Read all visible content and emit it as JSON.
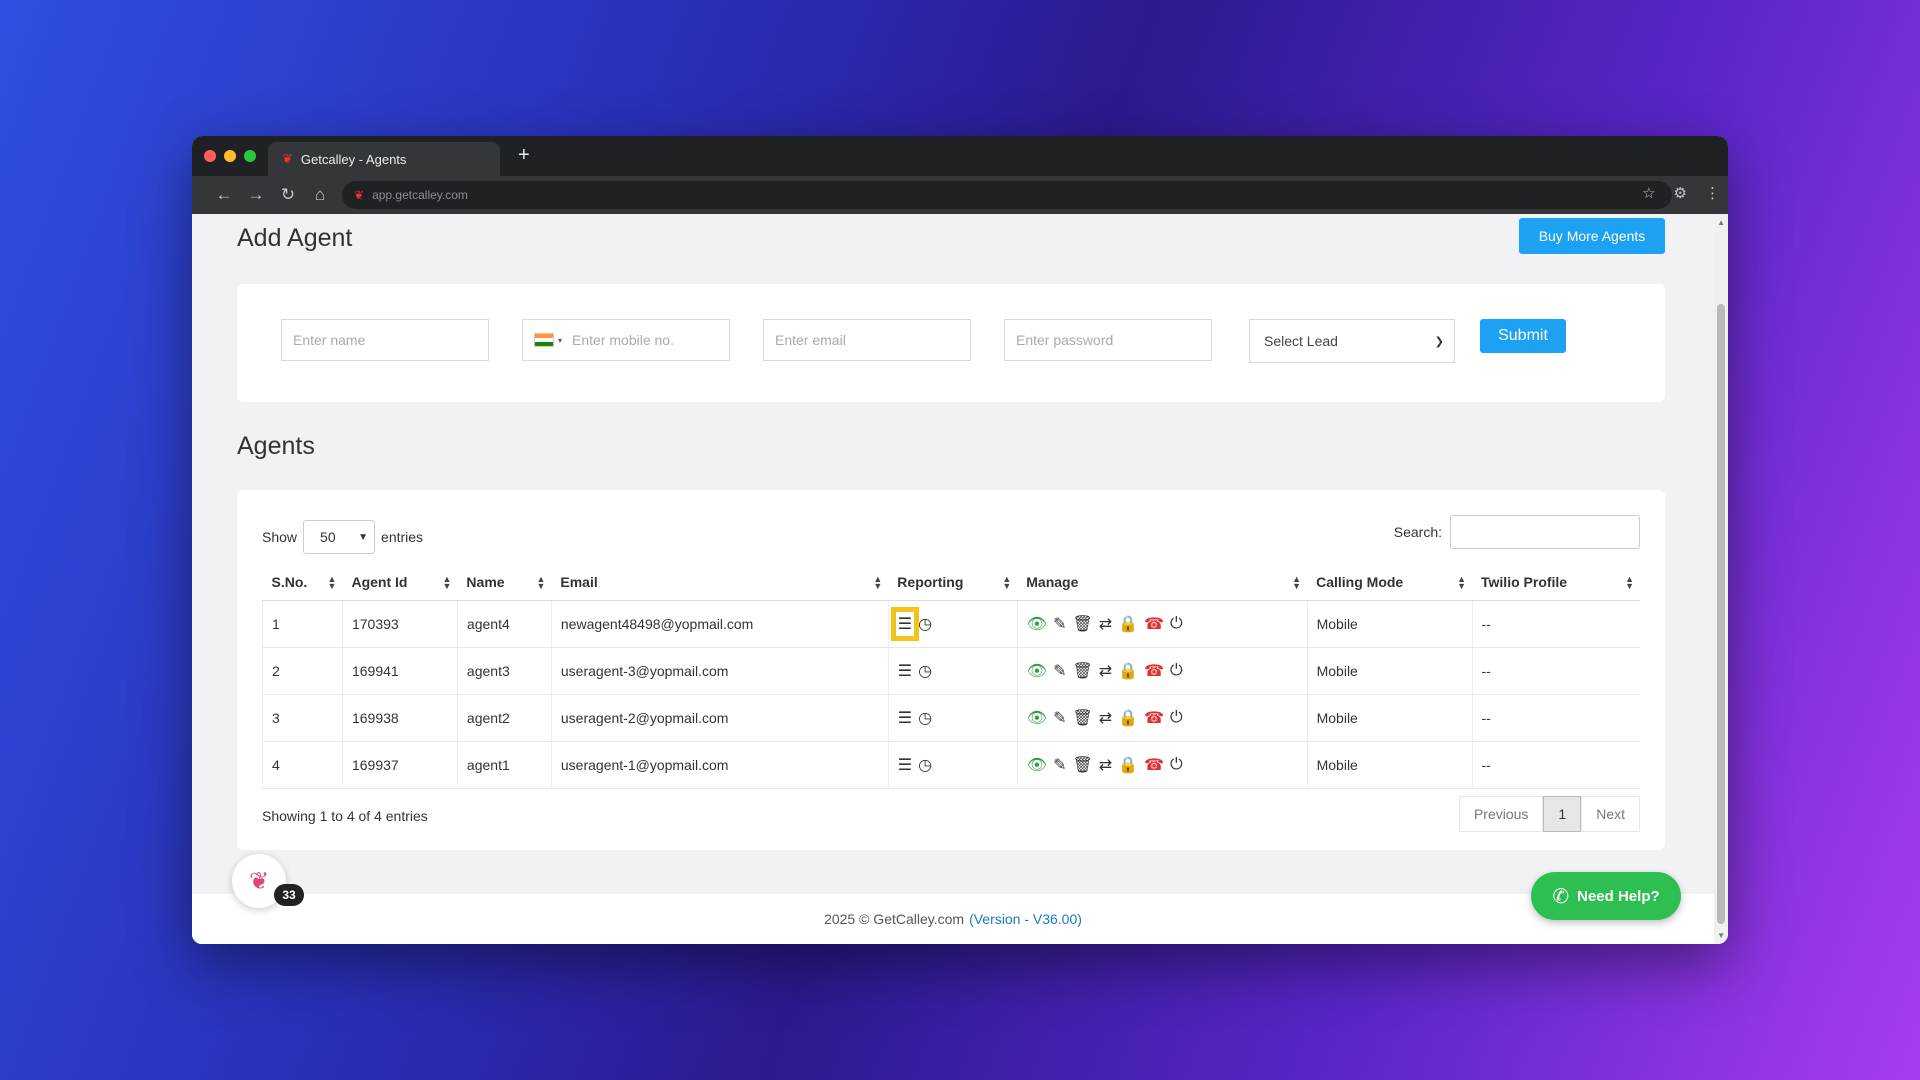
{
  "browser": {
    "tab_title": "Getcalley - Agents",
    "url": "app.getcalley.com"
  },
  "page": {
    "title": "Add Agent",
    "buy_more_label": "Buy More Agents"
  },
  "form": {
    "name_placeholder": "Enter name",
    "mobile_placeholder": "Enter mobile no.",
    "email_placeholder": "Enter email",
    "password_placeholder": "Enter password",
    "lead_select": "Select Lead",
    "submit_label": "Submit"
  },
  "agents_section": {
    "title": "Agents",
    "show_label": "Show",
    "entries_value": "50",
    "entries_label": "entries",
    "search_label": "Search:",
    "columns": [
      "S.No.",
      "Agent Id",
      "Name",
      "Email",
      "Reporting",
      "Manage",
      "Calling Mode",
      "Twilio Profile"
    ],
    "rows": [
      {
        "sno": "1",
        "agent_id": "170393",
        "name": "agent4",
        "email": "newagent48498@yopmail.com",
        "calling_mode": "Mobile",
        "twilio": "--"
      },
      {
        "sno": "2",
        "agent_id": "169941",
        "name": "agent3",
        "email": "useragent-3@yopmail.com",
        "calling_mode": "Mobile",
        "twilio": "--"
      },
      {
        "sno": "3",
        "agent_id": "169938",
        "name": "agent2",
        "email": "useragent-2@yopmail.com",
        "calling_mode": "Mobile",
        "twilio": "--"
      },
      {
        "sno": "4",
        "agent_id": "169937",
        "name": "agent1",
        "email": "useragent-1@yopmail.com",
        "calling_mode": "Mobile",
        "twilio": "--"
      }
    ],
    "showing_text": "Showing 1 to 4 of 4 entries",
    "pager": {
      "previous": "Previous",
      "current": "1",
      "next": "Next"
    }
  },
  "widget": {
    "badge_count": "33"
  },
  "footer": {
    "copyright": "2025 © GetCalley.com",
    "version": "(Version - V36.00)"
  },
  "help": {
    "label": "Need Help?"
  },
  "colors": {
    "accent": "#1da1f2",
    "help_green": "#2dbf52",
    "highlight": "#f2c318"
  }
}
